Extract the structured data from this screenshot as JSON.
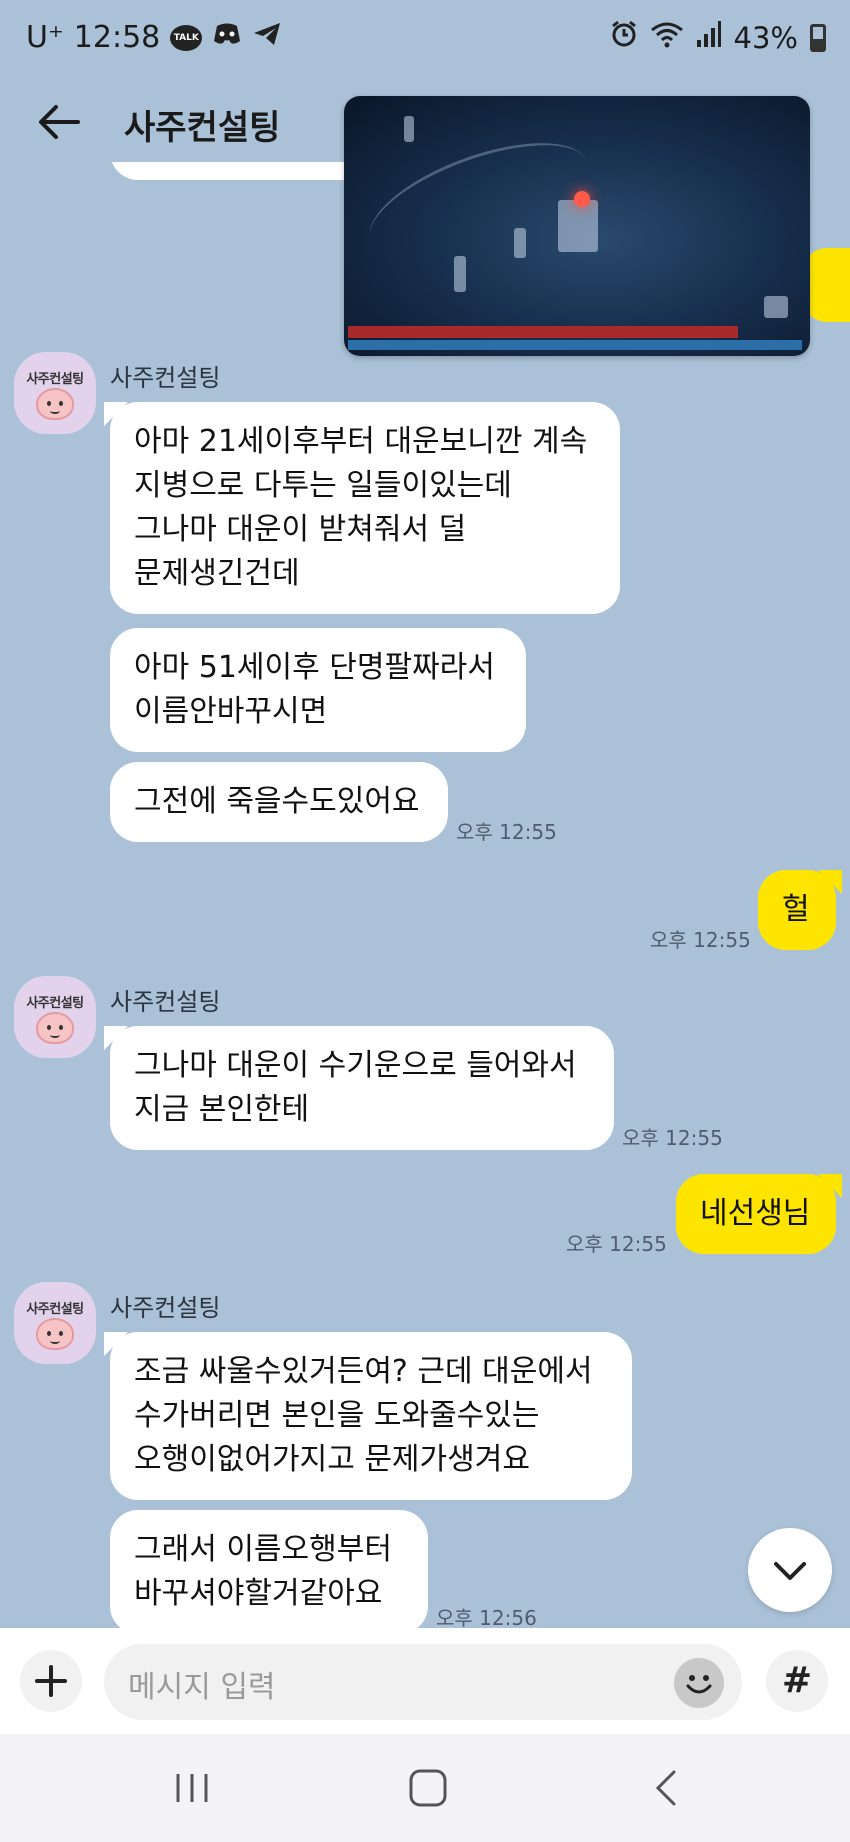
{
  "status_bar": {
    "carrier": "U⁺",
    "time": "12:58",
    "talk_icon_label": "TALK",
    "battery_percent": "43%",
    "icons_left": [
      "talk-icon",
      "discord-icon",
      "telegram-icon"
    ],
    "icons_right": [
      "alarm-icon",
      "wifi-icon",
      "signal-icon",
      "battery-icon"
    ]
  },
  "header": {
    "title": "사주컨설팅",
    "back_icon": "arrow-left-icon"
  },
  "video_overlay": {
    "health_fraction": 0.86
  },
  "messages": [
    {
      "type": "in",
      "sender": "사주컨설팅",
      "avatar_label": "사주컨설팅",
      "text": "아마 21세이후부터 대운보니깐 계속\n지병으로 다투는 일들이있는데\n그나마 대운이 받쳐줘서 덜\n문제생긴건데"
    },
    {
      "type": "in",
      "text": "아마 51세이후 단명팔짜라서\n이름안바꾸시면"
    },
    {
      "type": "in",
      "text": "그전에 죽을수도있어요",
      "time": "오후 12:55"
    },
    {
      "type": "out",
      "text": "헐",
      "time": "오후 12:55"
    },
    {
      "type": "in",
      "sender": "사주컨설팅",
      "avatar_label": "사주컨설팅",
      "text": "그나마 대운이 수기운으로 들어와서\n지금 본인한테",
      "time": "오후 12:55"
    },
    {
      "type": "out",
      "text": "네선생님",
      "time": "오후 12:55"
    },
    {
      "type": "in",
      "sender": "사주컨설팅",
      "avatar_label": "사주컨설팅",
      "text": "조금 싸울수있거든여? 근데 대운에서\n수가버리면 본인을 도와줄수있는\n오행이없어가지고 문제가생겨요"
    },
    {
      "type": "in",
      "text": "그래서 이름오행부터\n바꾸셔야할거같아요",
      "time": "오후 12:56"
    }
  ],
  "input": {
    "placeholder": "메시지 입력",
    "plus_icon": "plus-icon",
    "emoji_icon": "emoji-icon",
    "hash_label": "#"
  },
  "colors": {
    "chat_background": "#abc1d7",
    "incoming_bubble": "#ffffff",
    "outgoing_bubble": "#fee500",
    "avatar_background": "#e2d2ec"
  }
}
